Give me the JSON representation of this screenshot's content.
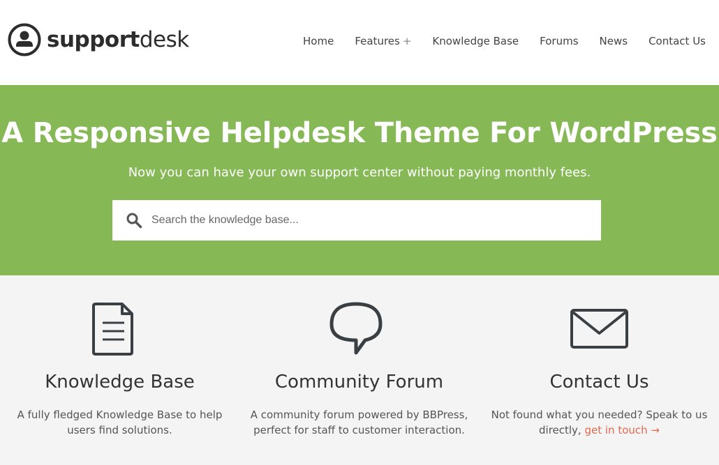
{
  "logo": {
    "bold": "support",
    "light": "desk"
  },
  "nav": {
    "home": "Home",
    "features": "Features",
    "features_plus": "+",
    "knowledge_base": "Knowledge Base",
    "forums": "Forums",
    "news": "News",
    "contact": "Contact Us"
  },
  "hero": {
    "title": "A Responsive Helpdesk Theme For WordPress",
    "subtitle": "Now you can have your own support center without paying monthly fees.",
    "search_placeholder": "Search the knowledge base..."
  },
  "features": [
    {
      "icon": "document-icon",
      "title": "Knowledge Base",
      "text": "A fully fledged Knowledge Base to help users find solutions."
    },
    {
      "icon": "speech-bubble-icon",
      "title": "Community Forum",
      "text": "A community forum powered by BBPress, perfect for staff to customer interaction."
    },
    {
      "icon": "envelope-icon",
      "title": "Contact Us",
      "text": "Not found what you needed? Speak to us directly,",
      "link": "get in touch →"
    }
  ],
  "colors": {
    "hero_bg": "#86b955",
    "link": "#e0694f",
    "icon": "#3a3f44"
  }
}
